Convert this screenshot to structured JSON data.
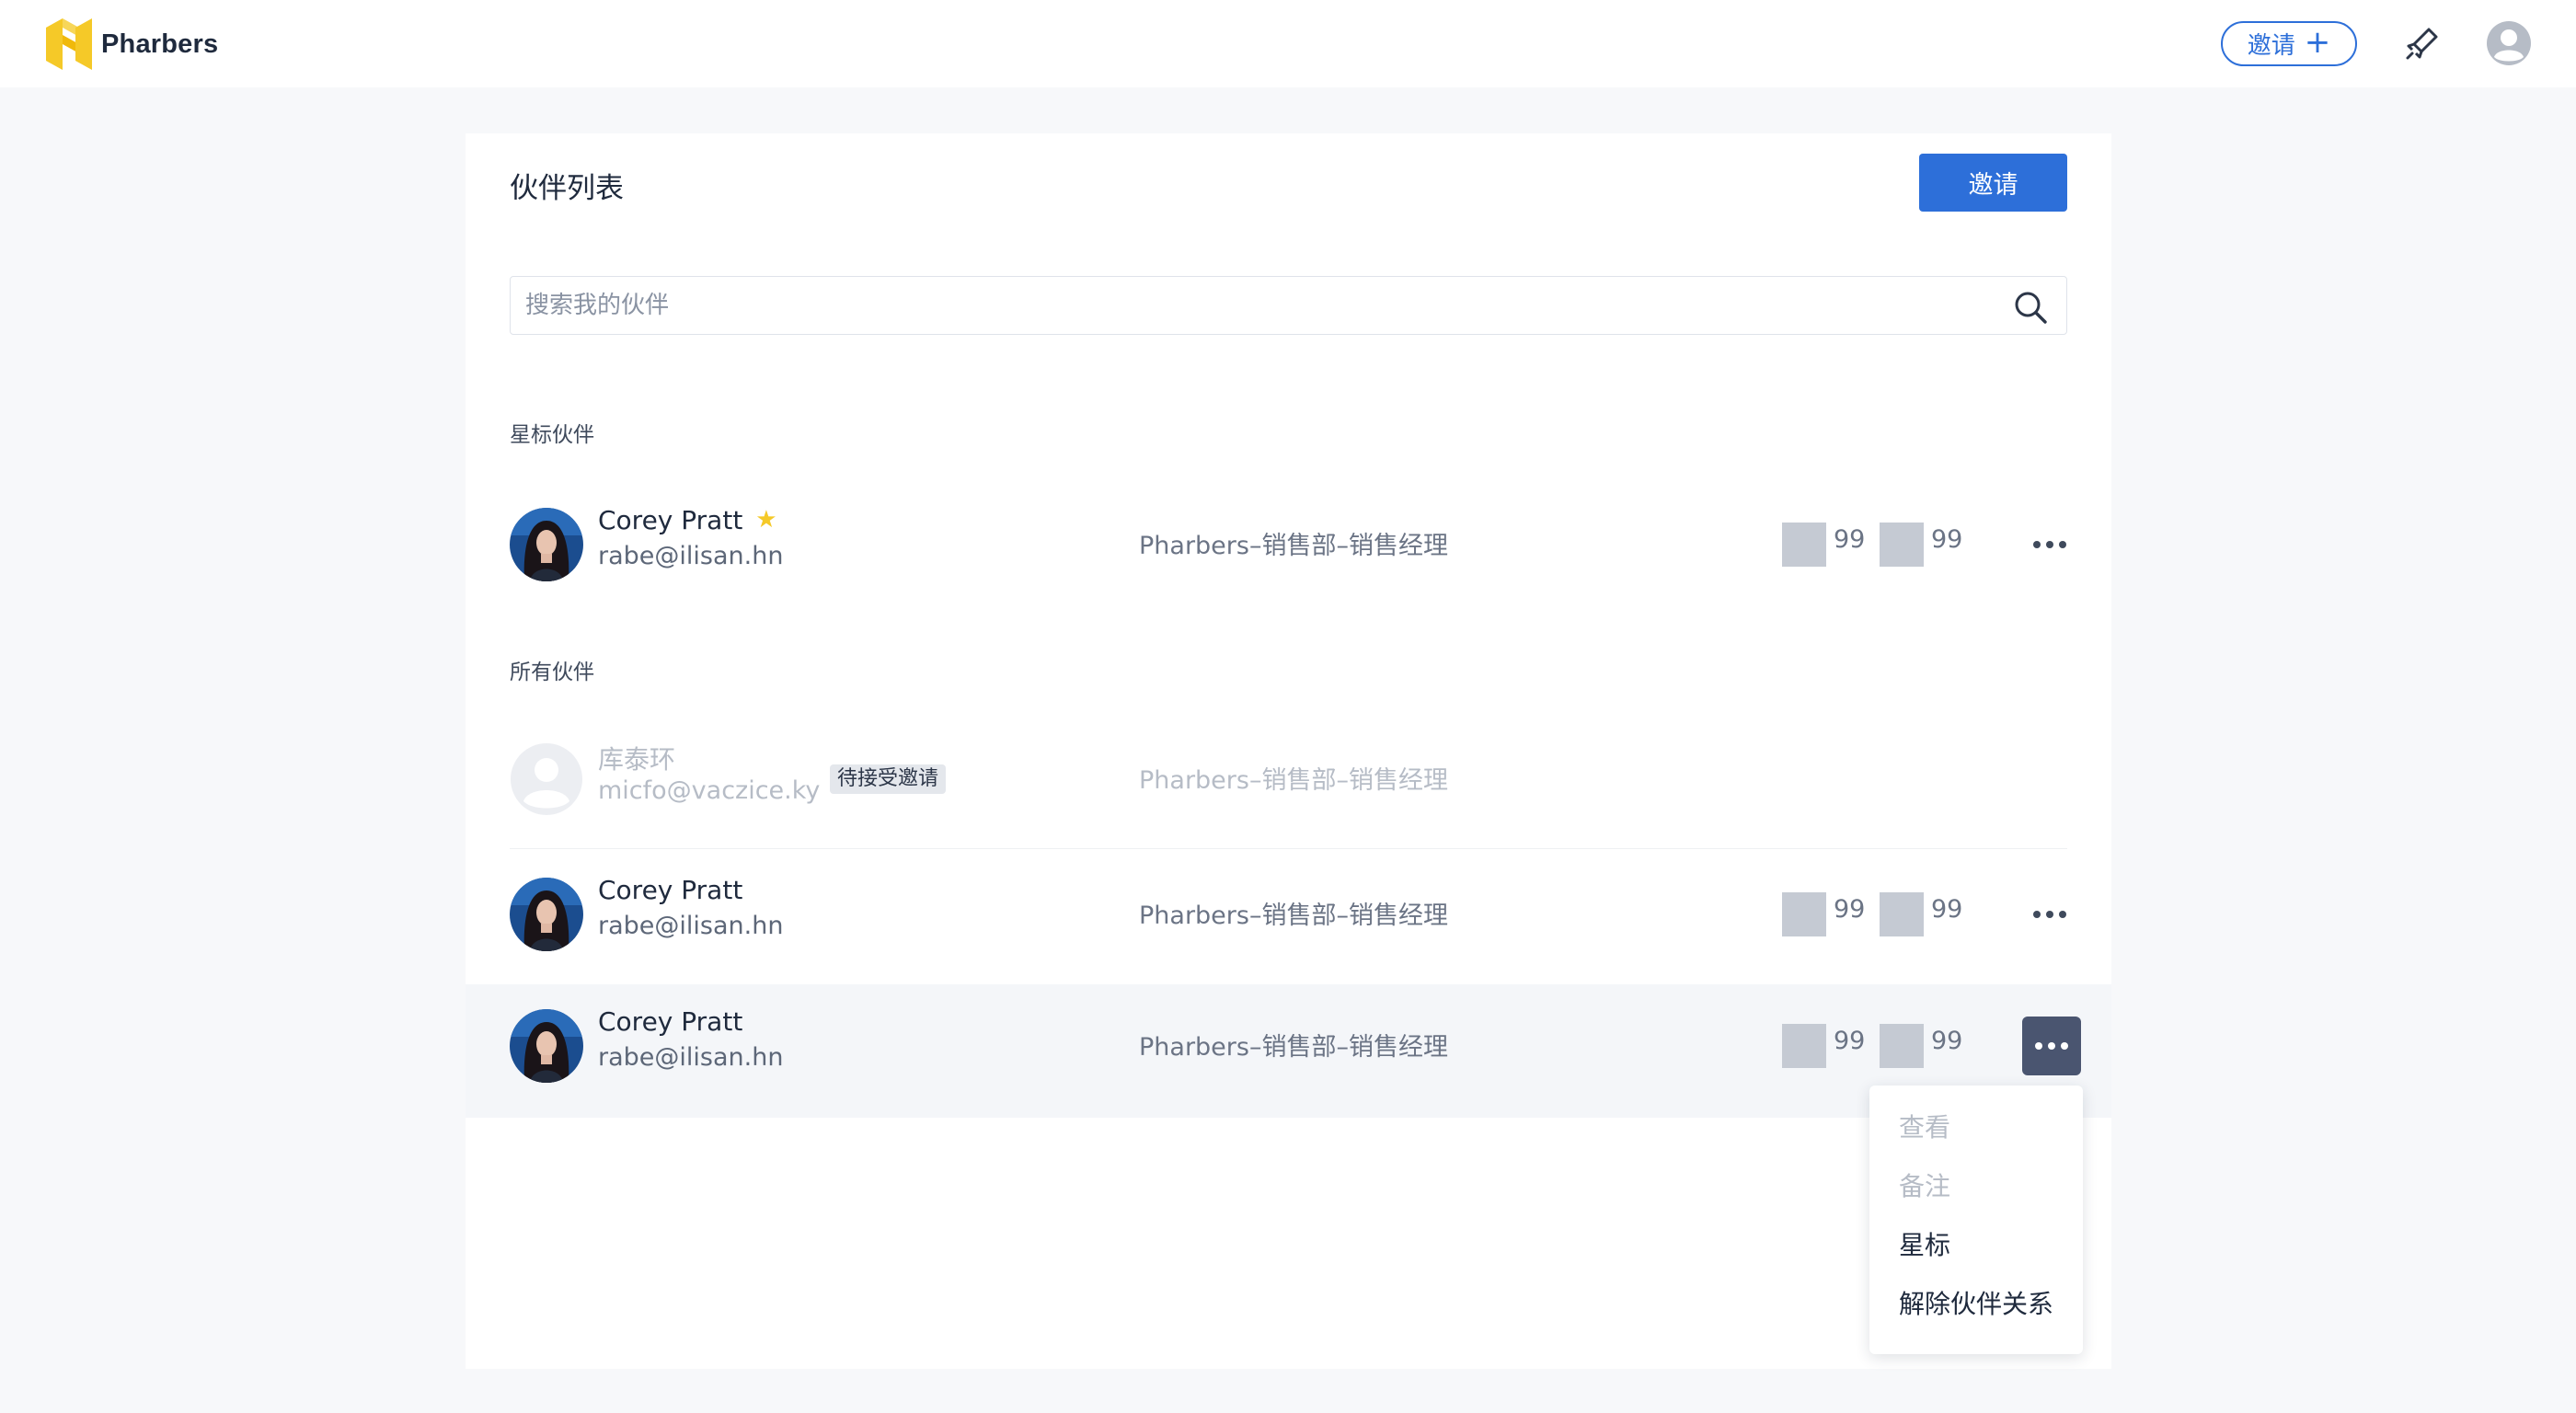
{
  "app": {
    "brand": "Pharbers",
    "brand_color": "#f5c928",
    "accent_color": "#2d6fd9"
  },
  "topbar": {
    "invite_label": "邀请",
    "invite_icon": "plus-icon",
    "rocket_icon": "rocket-icon",
    "avatar_icon": "user-avatar-icon"
  },
  "page": {
    "title": "伙伴列表",
    "invite_button": "邀请",
    "search": {
      "placeholder": "搜索我的伙伴",
      "value": "",
      "icon": "search-icon"
    }
  },
  "sections": {
    "starred_label": "星标伙伴",
    "all_label": "所有伙伴"
  },
  "starred": [
    {
      "name": "Corey Pratt",
      "email": "rabe@ilisan.hn",
      "dept": "Pharbers–销售部–销售经理",
      "stat1": "99",
      "stat2": "99",
      "starred": true,
      "star_icon": "star-icon"
    }
  ],
  "partners": [
    {
      "name": "库泰环",
      "email": "micfo@vaczice.ky",
      "dept": "Pharbers–销售部–销售经理",
      "status": "待接受邀请",
      "pending": true
    },
    {
      "name": "Corey Pratt",
      "email": "rabe@ilisan.hn",
      "dept": "Pharbers–销售部–销售经理",
      "stat1": "99",
      "stat2": "99"
    },
    {
      "name": "Corey Pratt",
      "email": "rabe@ilisan.hn",
      "dept": "Pharbers–销售部–销售经理",
      "stat1": "99",
      "stat2": "99",
      "hovered": true
    }
  ],
  "menu": {
    "items": [
      {
        "label": "查看",
        "disabled": true
      },
      {
        "label": "备注",
        "disabled": true
      },
      {
        "label": "星标",
        "disabled": false
      },
      {
        "label": "解除伙伴关系",
        "disabled": false
      }
    ]
  }
}
